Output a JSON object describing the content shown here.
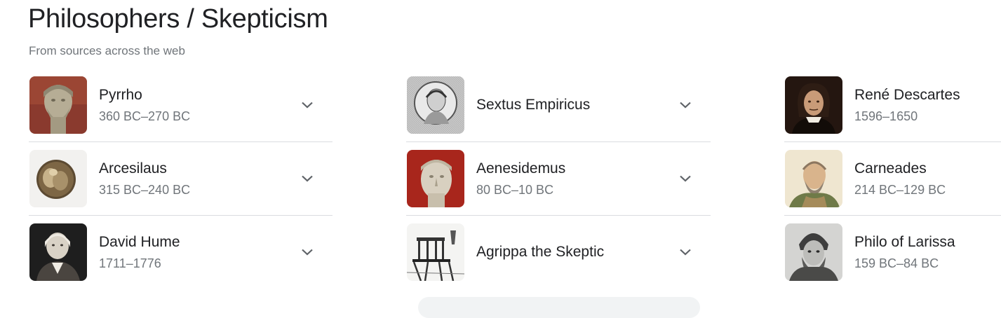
{
  "header": {
    "title": "Philosophers / Skepticism",
    "subtitle": "From sources across the web"
  },
  "columns": [
    {
      "items": [
        {
          "name": "Pyrrho",
          "dates": "360 BC–270 BC",
          "image": "pyrrho-bust-icon"
        },
        {
          "name": "Arcesilaus",
          "dates": "315 BC–240 BC",
          "image": "arcesilaus-coin-icon"
        },
        {
          "name": "David Hume",
          "dates": "1711–1776",
          "image": "david-hume-portrait-icon"
        }
      ]
    },
    {
      "items": [
        {
          "name": "Sextus Empiricus",
          "dates": "",
          "image": "sextus-empiricus-medallion-icon"
        },
        {
          "name": "Aenesidemus",
          "dates": "80 BC–10 BC",
          "image": "aenesidemus-bust-icon"
        },
        {
          "name": "Agrippa the Skeptic",
          "dates": "",
          "image": "agrippa-engraving-icon"
        }
      ]
    },
    {
      "items": [
        {
          "name": "René Descartes",
          "dates": "1596–1650",
          "image": "descartes-portrait-icon"
        },
        {
          "name": "Carneades",
          "dates": "214 BC–129 BC",
          "image": "carneades-portrait-icon"
        },
        {
          "name": "Philo of Larissa",
          "dates": "159 BC–84 BC",
          "image": "philo-engraving-icon"
        }
      ]
    }
  ],
  "icons": {
    "expand": "chevron-down-icon"
  },
  "colors": {
    "text": "#202124",
    "secondary": "#70757a",
    "divider": "#dadce0",
    "chevron": "#5f6368"
  }
}
